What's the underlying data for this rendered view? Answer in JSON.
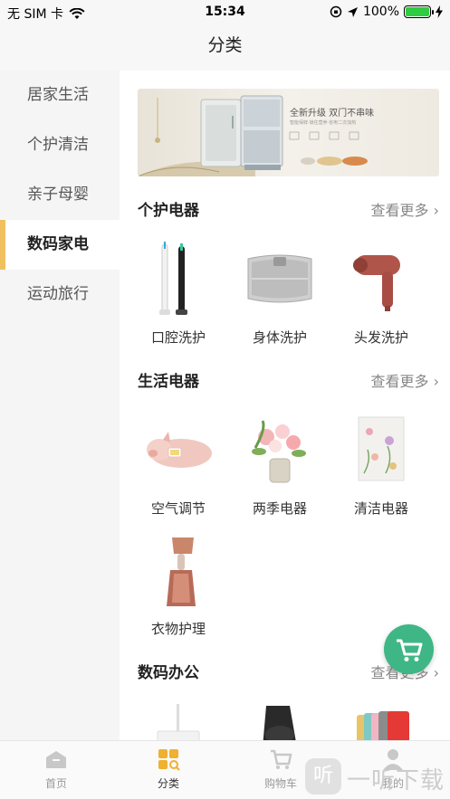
{
  "status": {
    "carrier": "无 SIM 卡",
    "time": "15:34",
    "battery": "100%",
    "battery_level": 1.0
  },
  "header": {
    "title": "分类"
  },
  "sidebar": {
    "items": [
      {
        "label": "居家生活"
      },
      {
        "label": "个护清洁"
      },
      {
        "label": "亲子母婴"
      },
      {
        "label": "数码家电"
      },
      {
        "label": "运动旅行"
      }
    ],
    "active_index": 3
  },
  "banner": {
    "headline": "全新升级 双门不串味",
    "subline": "智能保鲜·锁住营养·省电二次加热"
  },
  "sections": [
    {
      "title": "个护电器",
      "more": "查看更多",
      "items": [
        {
          "label": "口腔洗护"
        },
        {
          "label": "身体洗护"
        },
        {
          "label": "头发洗护"
        }
      ]
    },
    {
      "title": "生活电器",
      "more": "查看更多",
      "items": [
        {
          "label": "空气调节"
        },
        {
          "label": "两季电器"
        },
        {
          "label": "清洁电器"
        },
        {
          "label": "衣物护理"
        }
      ]
    },
    {
      "title": "数码办公",
      "more": "查看更多",
      "items": []
    }
  ],
  "tabbar": {
    "items": [
      {
        "label": "首页"
      },
      {
        "label": "分类"
      },
      {
        "label": "购物车"
      },
      {
        "label": "我的"
      }
    ],
    "active_index": 1
  },
  "watermark": {
    "badge": "听",
    "text": "一听下载"
  },
  "colors": {
    "accent": "#f0c060",
    "fab": "#3fb686",
    "tab_active": "#f0b030"
  }
}
